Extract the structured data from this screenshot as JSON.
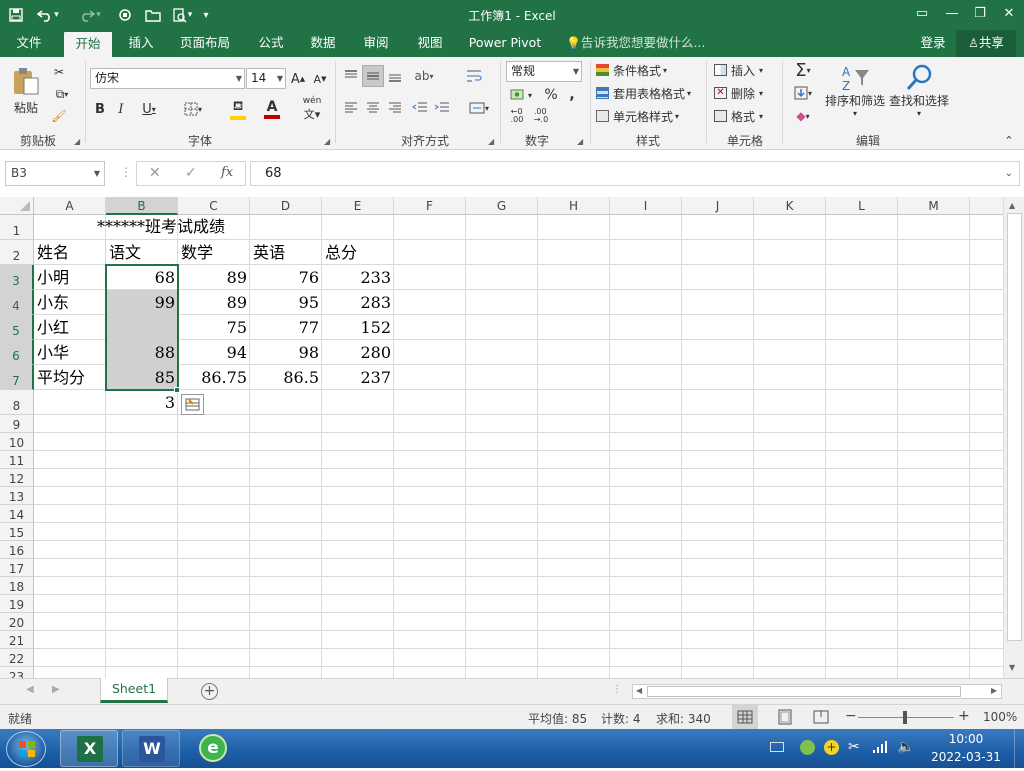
{
  "window": {
    "title": "工作簿1 - Excel",
    "min_symbol": "—",
    "restore_symbol": "❐",
    "close_symbol": "✕",
    "ribbon_display_symbol": "▭"
  },
  "quick_access": {
    "save_icon": "save-icon",
    "undo_icon": "undo-icon",
    "redo_icon": "redo-icon",
    "more": "▾"
  },
  "tabs": [
    "文件",
    "开始",
    "插入",
    "页面布局",
    "公式",
    "数据",
    "审阅",
    "视图",
    "Power Pivot"
  ],
  "active_tab": "开始",
  "tellme": "告诉我您想要做什么...",
  "login": "登录",
  "share": "共享",
  "ribbon": {
    "clipboard": {
      "paste": "粘贴",
      "label": "剪贴板"
    },
    "font": {
      "name": "仿宋",
      "size": "14",
      "bold": "B",
      "italic": "I",
      "underline": "U",
      "label": "字体",
      "grow": "A",
      "shrink": "A",
      "font_color_letter": "A",
      "wen": "wén"
    },
    "align": {
      "label": "对齐方式"
    },
    "number": {
      "format": "常规",
      "percent": "%",
      "comma": ",",
      "label": "数字"
    },
    "styles": {
      "cond": "条件格式",
      "table": "套用表格格式",
      "cell": "单元格样式",
      "label": "样式"
    },
    "cells": {
      "insert": "插入",
      "delete": "删除",
      "format": "格式",
      "label": "单元格"
    },
    "edit": {
      "sort": "排序和筛选",
      "find": "查找和选择",
      "label": "编辑"
    },
    "accent_red": "#c00000",
    "accent_yellow": "#ffd200"
  },
  "formula_bar": {
    "name_box": "B3",
    "cancel": "✕",
    "enter": "✓",
    "fx": "fx",
    "value": "68"
  },
  "grid": {
    "columns": [
      "A",
      "B",
      "C",
      "D",
      "E",
      "F",
      "G",
      "H",
      "I",
      "J",
      "K",
      "L",
      "M"
    ],
    "rows": [
      "1",
      "2",
      "3",
      "4",
      "5",
      "6",
      "7",
      "8",
      "9",
      "10",
      "11",
      "12",
      "13",
      "14",
      "15",
      "16",
      "17",
      "18",
      "19",
      "20",
      "21",
      "22",
      "23"
    ],
    "title": "******班考试成绩",
    "header": [
      "姓名",
      "语文",
      "数学",
      "英语",
      "总分"
    ],
    "data": [
      [
        "小明",
        "68",
        "89",
        "76",
        "233"
      ],
      [
        "小东",
        "99",
        "89",
        "95",
        "283"
      ],
      [
        "小红",
        "",
        "75",
        "77",
        "152"
      ],
      [
        "小华",
        "88",
        "94",
        "98",
        "280"
      ],
      [
        "平均分",
        "85",
        "86.75",
        "86.5",
        "237"
      ]
    ],
    "b8": "3",
    "selected_col": "B",
    "selection_color": "#217346"
  },
  "sheets": {
    "active": "Sheet1",
    "add": "+"
  },
  "status": {
    "ready": "就绪",
    "average": "平均值: 85",
    "count": "计数: 4",
    "sum": "求和: 340",
    "zoom": "100%",
    "minus": "−",
    "plus": "+"
  },
  "taskbar": {
    "time": "10:00",
    "date": "2022-03-31",
    "apps": [
      "excel-icon",
      "word-icon",
      "ie-icon"
    ]
  }
}
